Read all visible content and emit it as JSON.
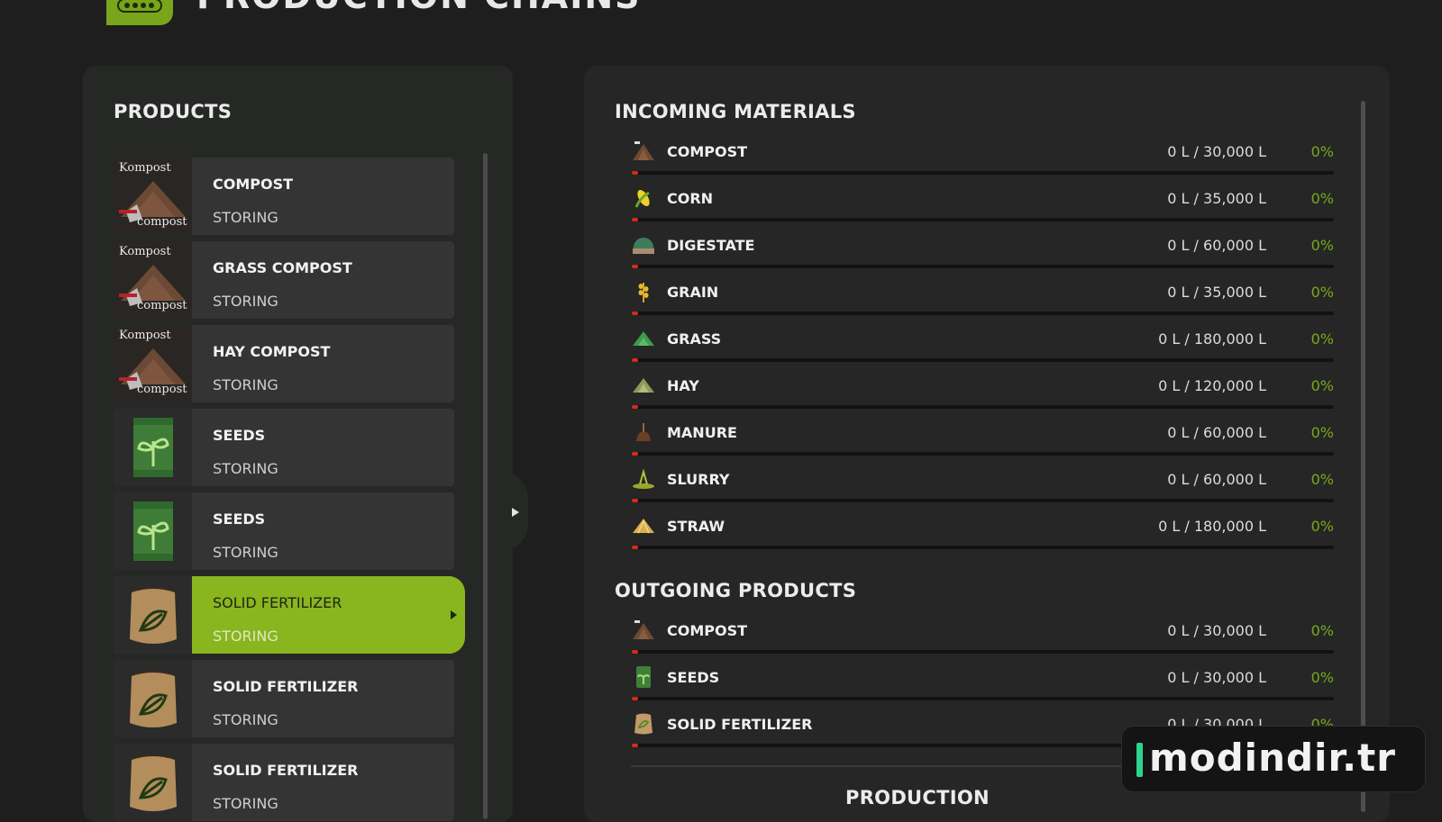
{
  "header": {
    "title": "PRODUCTION CHAINS"
  },
  "products_panel": {
    "heading": "PRODUCTS",
    "items": [
      {
        "name": "COMPOST",
        "status": "STORING",
        "icon": "compost-icon",
        "thumb_top": "Kompost",
        "thumb_bottom": "compost"
      },
      {
        "name": "GRASS COMPOST",
        "status": "STORING",
        "icon": "compost-icon",
        "thumb_top": "Kompost",
        "thumb_bottom": "compost"
      },
      {
        "name": "HAY COMPOST",
        "status": "STORING",
        "icon": "compost-icon",
        "thumb_top": "Kompost",
        "thumb_bottom": "compost"
      },
      {
        "name": "SEEDS",
        "status": "STORING",
        "icon": "seeds-icon"
      },
      {
        "name": "SEEDS",
        "status": "STORING",
        "icon": "seeds-icon"
      },
      {
        "name": "SOLID FERTILIZER",
        "status": "STORING",
        "icon": "fertilizer-sack-icon",
        "selected": true
      },
      {
        "name": "SOLID FERTILIZER",
        "status": "STORING",
        "icon": "fertilizer-sack-icon"
      },
      {
        "name": "SOLID FERTILIZER",
        "status": "STORING",
        "icon": "fertilizer-sack-icon"
      }
    ]
  },
  "incoming": {
    "heading": "INCOMING MATERIALS",
    "rows": [
      {
        "name": "COMPOST",
        "amount": "0 L / 30,000 L",
        "percent": "0%",
        "fill": 0,
        "icon": "compost-icon"
      },
      {
        "name": "CORN",
        "amount": "0 L / 35,000 L",
        "percent": "0%",
        "fill": 0,
        "icon": "corn-icon"
      },
      {
        "name": "DIGESTATE",
        "amount": "0 L / 60,000 L",
        "percent": "0%",
        "fill": 0,
        "icon": "digestate-icon"
      },
      {
        "name": "GRAIN",
        "amount": "0 L / 35,000 L",
        "percent": "0%",
        "fill": 0,
        "icon": "grain-icon"
      },
      {
        "name": "GRASS",
        "amount": "0 L / 180,000 L",
        "percent": "0%",
        "fill": 0,
        "icon": "grass-icon"
      },
      {
        "name": "HAY",
        "amount": "0 L / 120,000 L",
        "percent": "0%",
        "fill": 0,
        "icon": "hay-icon"
      },
      {
        "name": "MANURE",
        "amount": "0 L / 60,000 L",
        "percent": "0%",
        "fill": 0,
        "icon": "manure-icon"
      },
      {
        "name": "SLURRY",
        "amount": "0 L / 60,000 L",
        "percent": "0%",
        "fill": 0,
        "icon": "slurry-icon"
      },
      {
        "name": "STRAW",
        "amount": "0 L / 180,000 L",
        "percent": "0%",
        "fill": 0,
        "icon": "straw-icon"
      }
    ]
  },
  "outgoing": {
    "heading": "OUTGOING PRODUCTS",
    "rows": [
      {
        "name": "COMPOST",
        "amount": "0 L / 30,000 L",
        "percent": "0%",
        "fill": 0,
        "icon": "compost-icon"
      },
      {
        "name": "SEEDS",
        "amount": "0 L / 30,000 L",
        "percent": "0%",
        "fill": 0,
        "icon": "seeds-icon"
      },
      {
        "name": "SOLID FERTILIZER",
        "amount": "0 L / 30,000 L",
        "percent": "0%",
        "fill": 0,
        "icon": "fertilizer-sack-icon"
      }
    ]
  },
  "production": {
    "heading": "PRODUCTION"
  },
  "watermark": {
    "text": "modindir.tr"
  },
  "colors": {
    "accent": "#89b51f",
    "percent_text": "#7aa81c",
    "fill_bar": "#d62a1e",
    "panel_bg": "#262826"
  }
}
